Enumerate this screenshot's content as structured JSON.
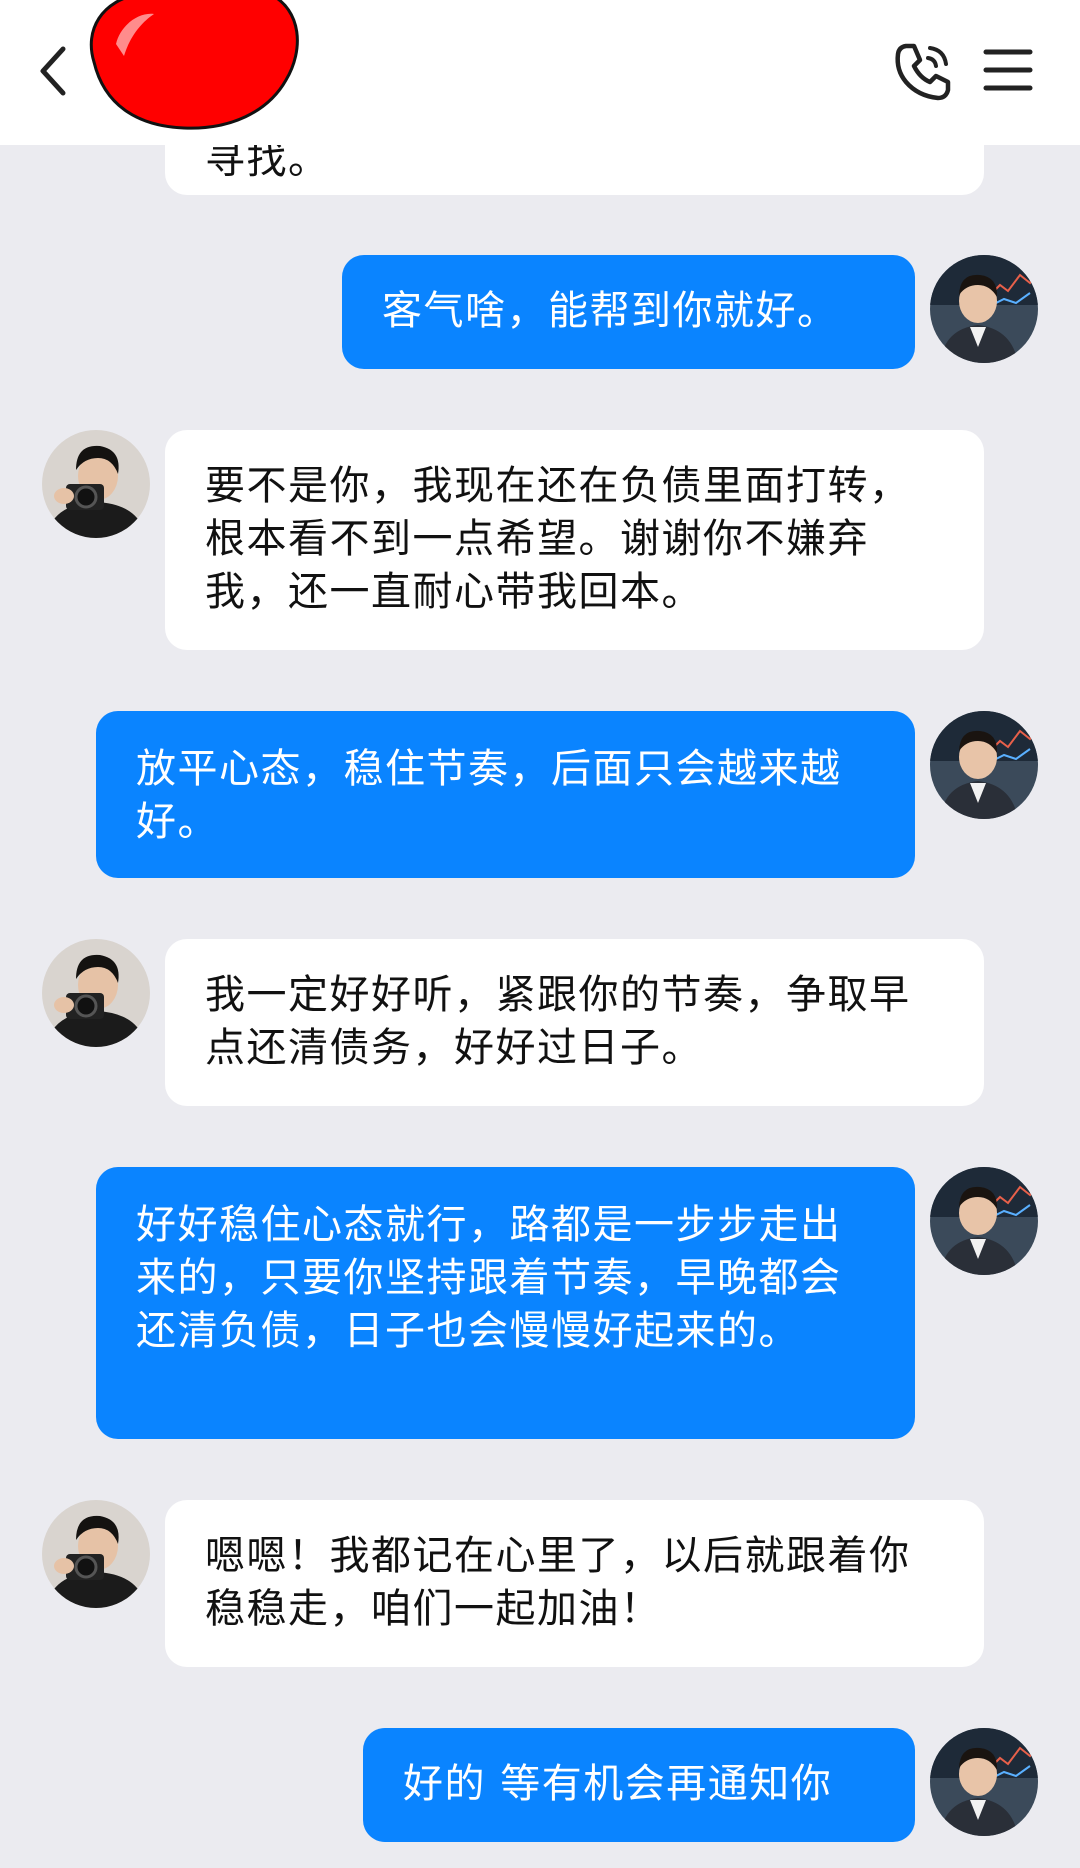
{
  "header": {
    "back_icon": "chevron-left-icon",
    "call_icon": "phone-icon",
    "menu_icon": "hamburger-menu-icon",
    "contact_name_redacted": true
  },
  "messages": [
    {
      "side": "in",
      "text": "寻找。"
    },
    {
      "side": "out",
      "text": "客气啥，能帮到你就好。"
    },
    {
      "side": "in",
      "text": "要不是你，我现在还在负债里面打转，根本看不到一点希望。谢谢你不嫌弃我，还一直耐心带我回本。"
    },
    {
      "side": "out",
      "text": "放平心态，稳住节奏，后面只会越来越好。"
    },
    {
      "side": "in",
      "text": "我一定好好听，紧跟你的节奏，争取早点还清债务，好好过日子。"
    },
    {
      "side": "out",
      "text": "好好稳住心态就行，路都是一步步走出来的，只要你坚持跟着节奏，早晚都会还清负债，日子也会慢慢好起来的。"
    },
    {
      "side": "in",
      "text": "嗯嗯！我都记在心里了，以后就跟着你稳稳走，咱们一起加油！"
    },
    {
      "side": "out",
      "text": "好的 等有机会再通知你"
    }
  ],
  "colors": {
    "background": "#ebebf0",
    "outgoing_bubble": "#0a84ff",
    "incoming_bubble": "#ffffff",
    "redaction": "#ff0000"
  }
}
